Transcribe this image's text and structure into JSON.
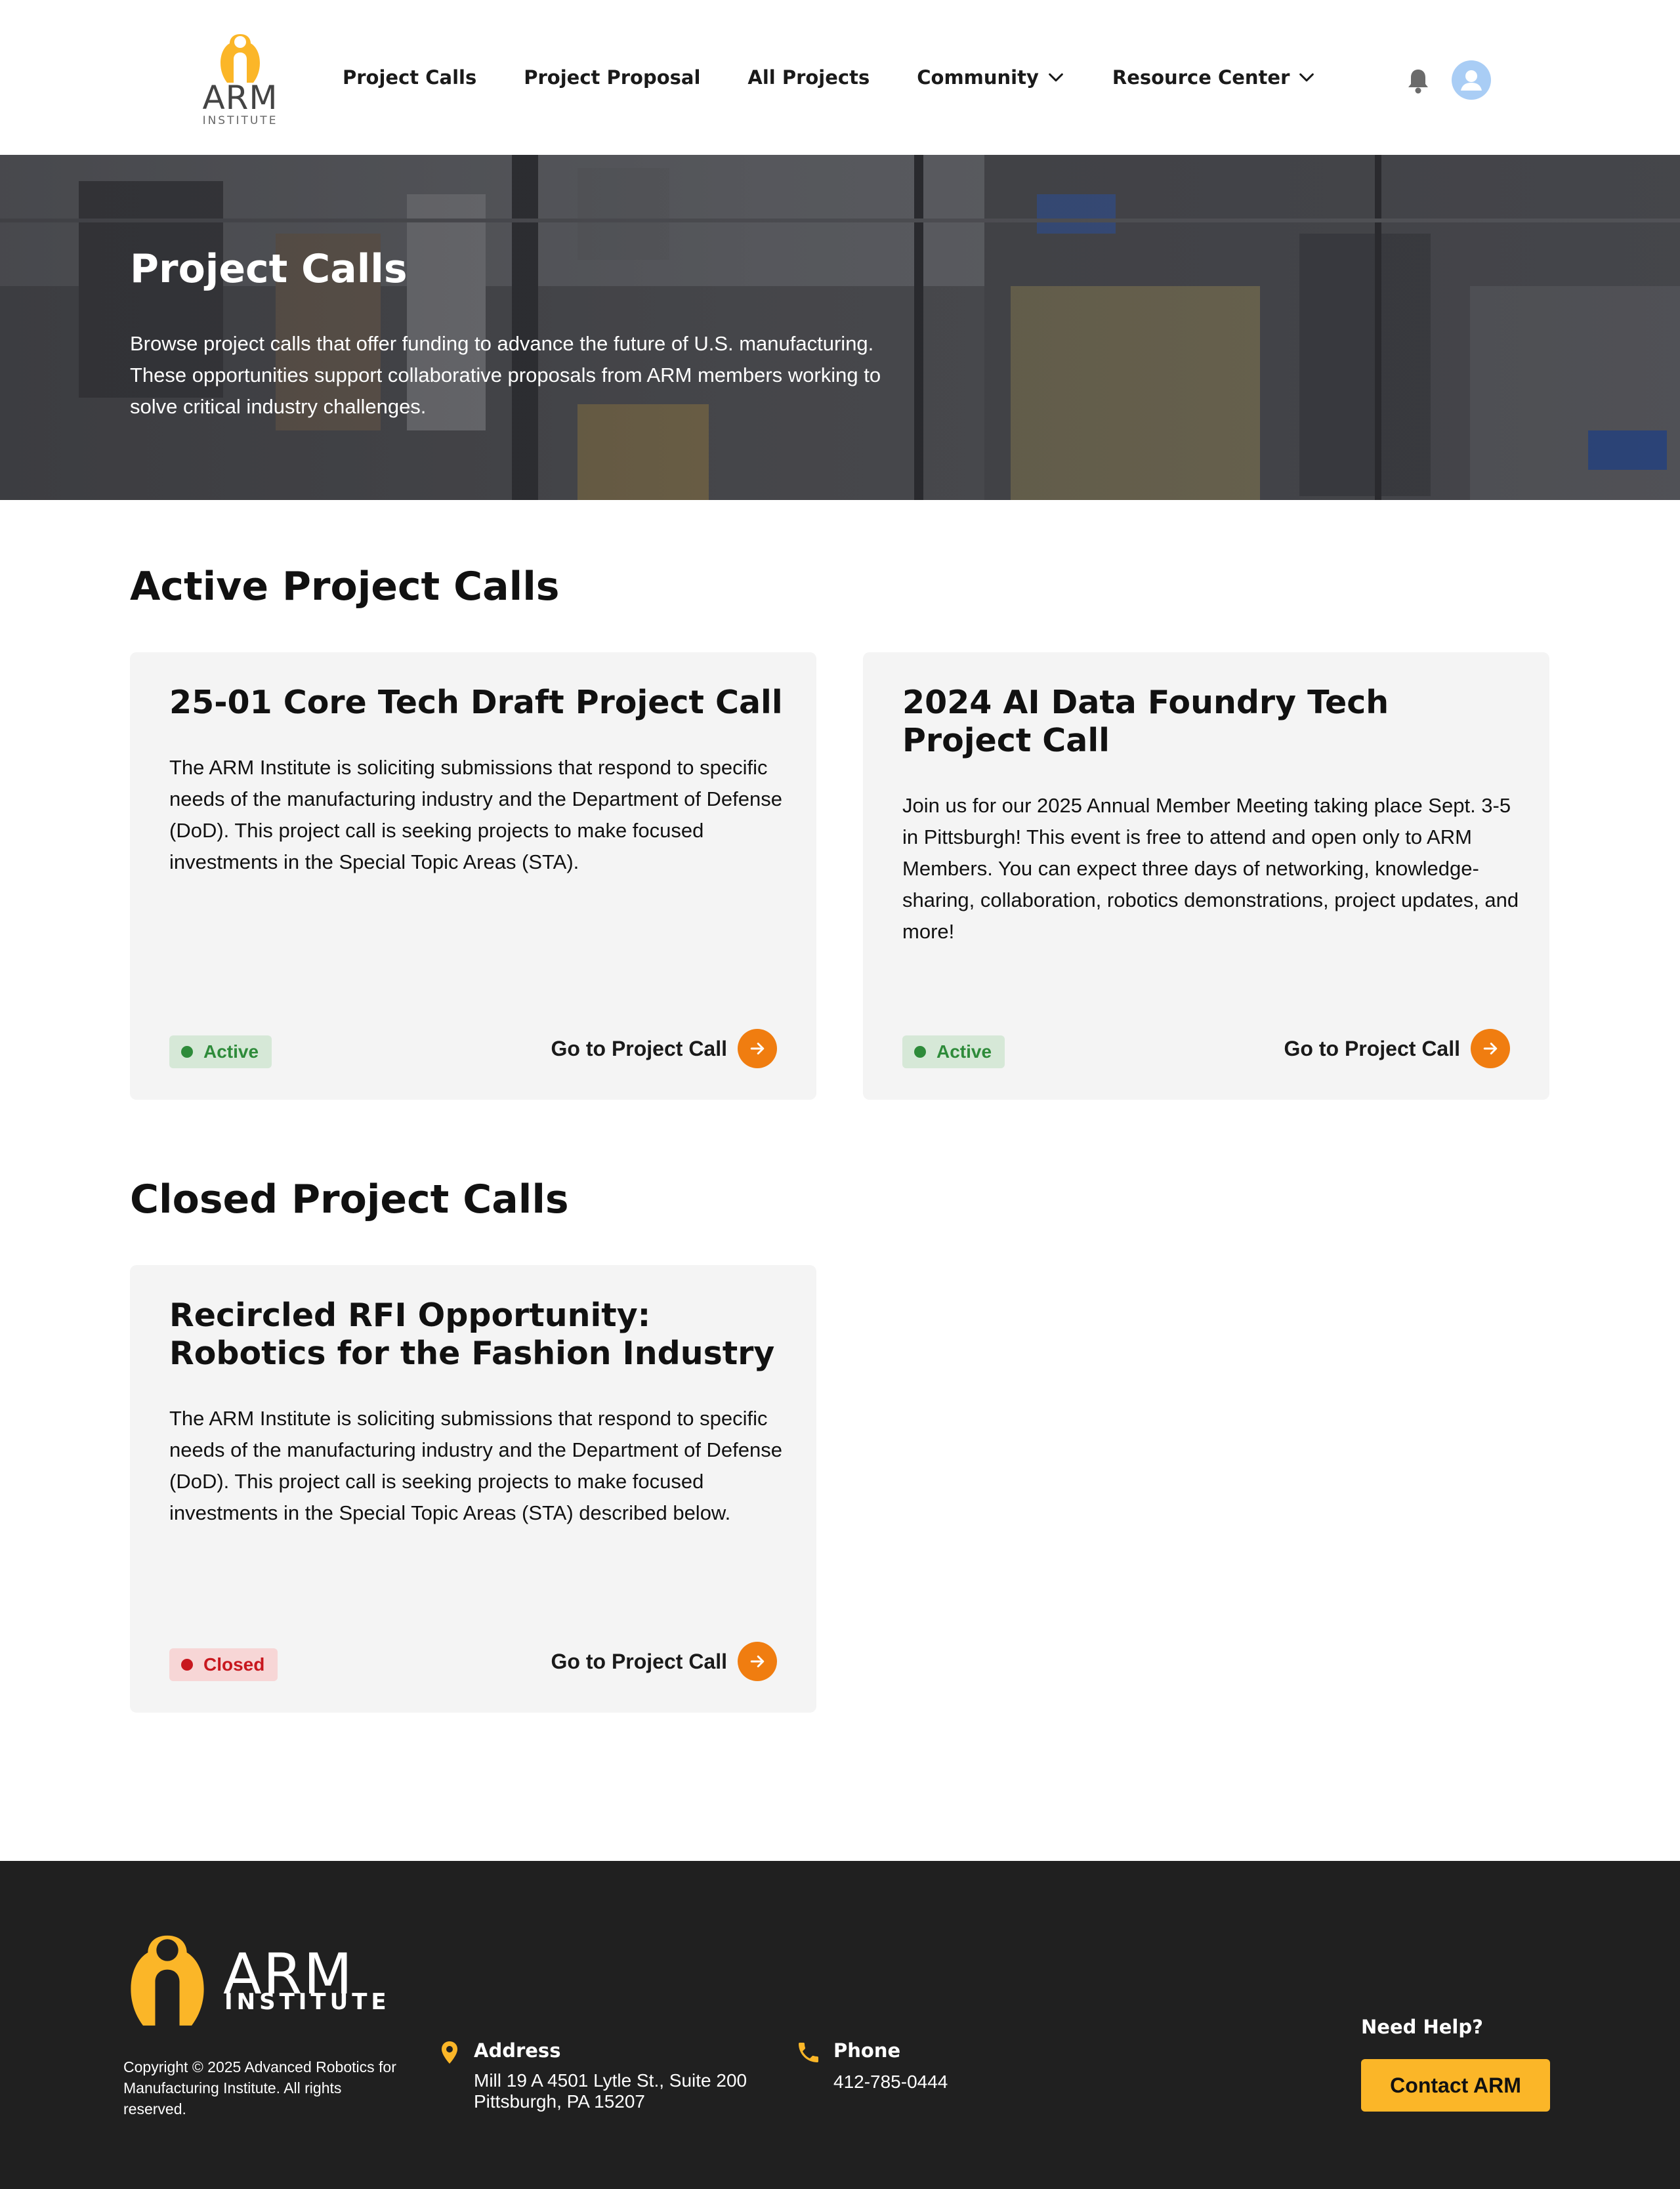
{
  "brand": {
    "logo_text": "ARM",
    "logo_subtext": "INSTITUTE",
    "accent_color": "#f07d10",
    "logo_color": "#fbb628"
  },
  "nav": {
    "items": [
      {
        "label": "Project Calls",
        "has_dropdown": false
      },
      {
        "label": "Project Proposal",
        "has_dropdown": false
      },
      {
        "label": "All Projects",
        "has_dropdown": false
      },
      {
        "label": "Community",
        "has_dropdown": true
      },
      {
        "label": "Resource Center",
        "has_dropdown": true
      }
    ]
  },
  "hero": {
    "title": "Project Calls",
    "description": "Browse project calls that offer funding to advance the future of U.S. manufacturing. These opportunities support collaborative proposals from ARM members working to solve critical industry challenges."
  },
  "active_section": {
    "title": "Active Project Calls",
    "cards": [
      {
        "title": "25-01 Core Tech Draft Project Call",
        "description": "The ARM Institute is soliciting submissions that respond to specific needs of the manufacturing industry and the Department of Defense (DoD). This project call is seeking projects to make focused investments in the Special Topic Areas (STA).",
        "status": "Active",
        "link_label": "Go to Project Call"
      },
      {
        "title": "2024 AI Data Foundry Tech Project Call",
        "description": "Join us for our 2025 Annual Member Meeting taking place Sept. 3-5 in Pittsburgh! This event is free to attend and open only to ARM Members. You can expect three days of networking, knowledge-sharing, collaboration, robotics demonstrations, project updates, and more!",
        "status": "Active",
        "link_label": "Go to Project Call"
      }
    ]
  },
  "closed_section": {
    "title": "Closed Project Calls",
    "cards": [
      {
        "title": "Recircled RFI Opportunity: Robotics for the Fashion Industry",
        "description": "The ARM Institute is soliciting submissions that respond to specific needs of the manufacturing industry and the Department of Defense (DoD). This project call is seeking projects to make focused investments in the Special Topic Areas (STA) described below.",
        "status": "Closed",
        "link_label": "Go to Project Call"
      }
    ]
  },
  "footer": {
    "logo_text": "ARM",
    "logo_subtext": "INSTITUTE",
    "copyright": "Copyright © 2025 Advanced Robotics for Manufacturing Institute. All rights reserved.",
    "address_label": "Address",
    "address_line1": "Mill 19 A 4501 Lytle St., Suite 200",
    "address_line2": "Pittsburgh, PA 15207",
    "phone_label": "Phone",
    "phone": "412-785-0444",
    "help_label": "Need Help?",
    "contact_button": "Contact ARM"
  }
}
